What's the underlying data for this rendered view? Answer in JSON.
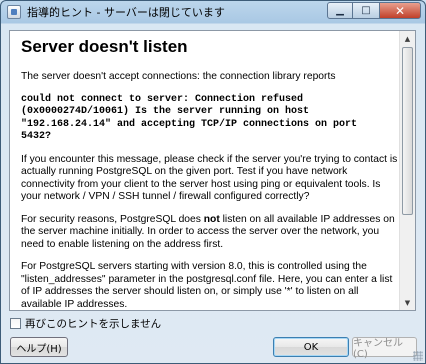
{
  "window": {
    "title": "指導的ヒント - サーバーは閉じています"
  },
  "caption_buttons": {
    "minimize_icon": "minimize-icon",
    "maximize_icon": "maximize-icon",
    "close_icon": "close-icon"
  },
  "hint": {
    "heading": "Server doesn't listen",
    "intro": "The server doesn't accept connections: the connection library reports",
    "error_code": "could not connect to server: Connection refused\n(0x0000274D/10061) Is the server running on host\n\"192.168.24.14\" and accepting TCP/IP connections on port\n5432?",
    "para_check": "If you encounter this message, please check if the server you're trying to contact is actually running PostgreSQL on the given port. Test if you have network connectivity from your client to the server host using ping or equivalent tools. Is your network / VPN / SSH tunnel / firewall configured correctly?",
    "para_security_before": "For security reasons, PostgreSQL does ",
    "para_security_bold": "not",
    "para_security_after": " listen on all available IP addresses on the server machine initially. In order to access the server over the network, you need to enable listening on the address first.",
    "para_listen": "For PostgreSQL servers starting with version 8.0, this is controlled using the \"listen_addresses\" parameter in the postgresql.conf file. Here, you can enter a list of IP addresses the server should listen on, or simply use '*' to listen on all available IP addresses."
  },
  "footer": {
    "dont_show_label": "再びこのヒントを示しません",
    "dont_show_checked": false,
    "help_label": "ヘルプ(H)",
    "ok_label": "OK",
    "cancel_label": "キャンセル(C)"
  }
}
